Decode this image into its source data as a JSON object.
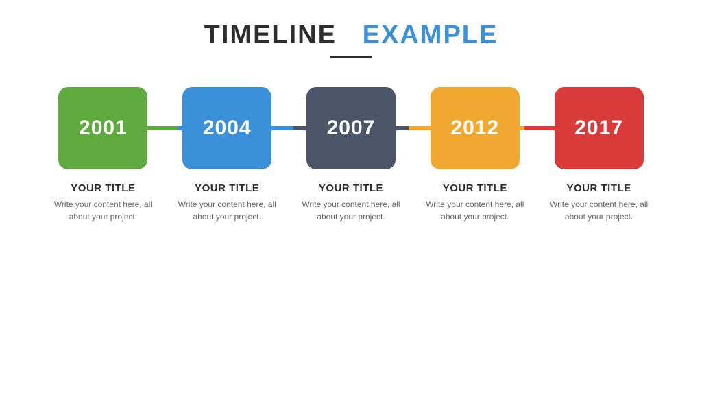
{
  "header": {
    "title_dark": "TIMELINE",
    "title_blue": "EXAMPLE",
    "divider": true
  },
  "timeline": {
    "items": [
      {
        "year": "2001",
        "color_class": "box-green",
        "line_class": "line-seg-green",
        "title": "YOUR TITLE",
        "body": "Write your content here, all about your project."
      },
      {
        "year": "2004",
        "color_class": "box-blue",
        "line_class": "line-seg-blue",
        "title": "YOUR TITLE",
        "body": "Write your content here, all about your project."
      },
      {
        "year": "2007",
        "color_class": "box-dark",
        "line_class": "line-seg-dark",
        "title": "YOUR TITLE",
        "body": "Write your content here, all about your project."
      },
      {
        "year": "2012",
        "color_class": "box-orange",
        "line_class": "line-seg-orange",
        "title": "YOUR TITLE",
        "body": "Write your content here, all about your project."
      },
      {
        "year": "2017",
        "color_class": "box-red",
        "line_class": "line-seg-red",
        "title": "YOUR TITLE",
        "body": "Write your content here, all about your project."
      }
    ]
  }
}
